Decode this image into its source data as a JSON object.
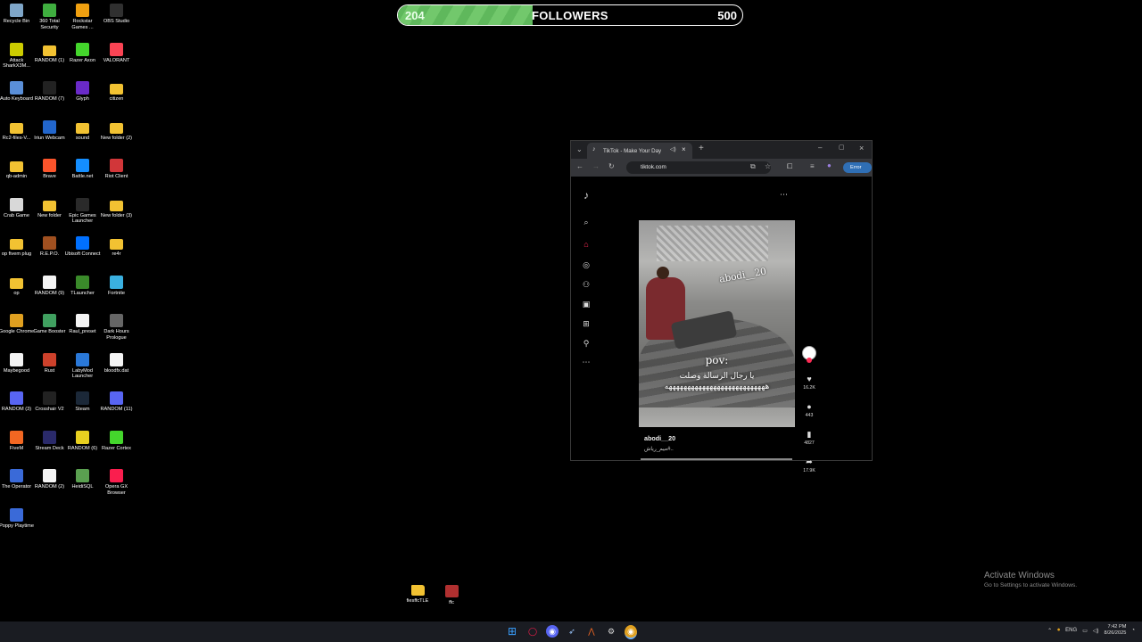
{
  "follower_bar": {
    "current": "204",
    "label": "FOLLOWERS",
    "goal": "500",
    "progress_fraction": 0.39
  },
  "desktop_icons": [
    {
      "label": "Recycle Bin",
      "icon": "recycle-bin-icon",
      "color": "#7fa6c8"
    },
    {
      "label": "360 Total Security",
      "icon": "shield-icon",
      "color": "#3fae3f"
    },
    {
      "label": "Rockstar Games ...",
      "icon": "rockstar-icon",
      "color": "#f0a010"
    },
    {
      "label": "OBS Studio",
      "icon": "obs-icon",
      "color": "#303030"
    },
    {
      "label": "Attack SharkX3M...",
      "icon": "mouse-icon",
      "color": "#cccc00"
    },
    {
      "label": "RANDOM (1)",
      "icon": "folder-icon",
      "color": "#f2c232"
    },
    {
      "label": "Razer Axon",
      "icon": "razer-icon",
      "color": "#44d62c"
    },
    {
      "label": "VALORANT",
      "icon": "valorant-icon",
      "color": "#fa4454"
    },
    {
      "label": "Auto Keyboard",
      "icon": "keyboard-icon",
      "color": "#5a8fd8"
    },
    {
      "label": "RANDOM (7)",
      "icon": "capcut-icon",
      "color": "#222222"
    },
    {
      "label": "Glyph",
      "icon": "glyph-icon",
      "color": "#6a2ac8"
    },
    {
      "label": "citizen",
      "icon": "folder-icon",
      "color": "#f2c232"
    },
    {
      "label": "Rc2-files-V...",
      "icon": "folder-icon",
      "color": "#f2c232"
    },
    {
      "label": "Iriun Webcam",
      "icon": "webcam-icon",
      "color": "#2266cc"
    },
    {
      "label": "sound",
      "icon": "folder-icon",
      "color": "#f2c232"
    },
    {
      "label": "New folder (2)",
      "icon": "folder-icon",
      "color": "#f2c232"
    },
    {
      "label": "qb-admin",
      "icon": "folder-icon",
      "color": "#f2c232"
    },
    {
      "label": "Brave",
      "icon": "brave-icon",
      "color": "#fb542b"
    },
    {
      "label": "Battle.net",
      "icon": "battlenet-icon",
      "color": "#148eff"
    },
    {
      "label": "Riot Client",
      "icon": "riot-icon",
      "color": "#d13639"
    },
    {
      "label": "Crab Game",
      "icon": "crab-icon",
      "color": "#d8d8d8"
    },
    {
      "label": "New folder",
      "icon": "folder-icon",
      "color": "#f2c232"
    },
    {
      "label": "Epic Games Launcher",
      "icon": "epic-icon",
      "color": "#2a2a2a"
    },
    {
      "label": "New folder (3)",
      "icon": "folder-icon",
      "color": "#f2c232"
    },
    {
      "label": "op fivem plug",
      "icon": "folder-icon",
      "color": "#f2c232"
    },
    {
      "label": "R.E.P.O.",
      "icon": "repo-icon",
      "color": "#a05020"
    },
    {
      "label": "Ubisoft Connect",
      "icon": "ubisoft-icon",
      "color": "#0070ff"
    },
    {
      "label": "re4r",
      "icon": "folder-icon",
      "color": "#f2c232"
    },
    {
      "label": "op",
      "icon": "folder-icon",
      "color": "#f2c232"
    },
    {
      "label": "RANDOM (9)",
      "icon": "file-icon",
      "color": "#f4f4f4"
    },
    {
      "label": "TLauncher",
      "icon": "tlauncher-icon",
      "color": "#3a8a2a"
    },
    {
      "label": "Fortnite",
      "icon": "fortnite-icon",
      "color": "#3ab0e0"
    },
    {
      "label": "Google Chrome",
      "icon": "chrome-icon",
      "color": "#e0a020"
    },
    {
      "label": "Game Booster",
      "icon": "game-booster-icon",
      "color": "#40a060"
    },
    {
      "label": "Raul_preset",
      "icon": "file-icon",
      "color": "#f4f4f4"
    },
    {
      "label": "Dark Hours Prologue",
      "icon": "dark-hours-icon",
      "color": "#666666"
    },
    {
      "label": "Maybegood",
      "icon": "file-icon",
      "color": "#f4f4f4"
    },
    {
      "label": "Rust",
      "icon": "rust-icon",
      "color": "#cd412b"
    },
    {
      "label": "LabyMod Launcher",
      "icon": "labymod-icon",
      "color": "#2a78d8"
    },
    {
      "label": "bloodfx.dat",
      "icon": "file-icon",
      "color": "#f4f4f4"
    },
    {
      "label": "RANDOM (3)",
      "icon": "discord-icon",
      "color": "#5865f2"
    },
    {
      "label": "Crosshair V2",
      "icon": "crosshair-icon",
      "color": "#222222"
    },
    {
      "label": "Steam",
      "icon": "steam-icon",
      "color": "#1b2838"
    },
    {
      "label": "RANDOM (11)",
      "icon": "discord-icon",
      "color": "#5865f2"
    },
    {
      "label": "FiveM",
      "icon": "fivem-icon",
      "color": "#f26722"
    },
    {
      "label": "Stream Deck",
      "icon": "stream-deck-icon",
      "color": "#2a2a6a"
    },
    {
      "label": "RANDOM (6)",
      "icon": "random-icon",
      "color": "#e8d020"
    },
    {
      "label": "Razer Cortex",
      "icon": "razer-cortex-icon",
      "color": "#44d62c"
    },
    {
      "label": "The Operator",
      "icon": "operator-icon",
      "color": "#3a6ad8"
    },
    {
      "label": "RANDOM (2)",
      "icon": "file-icon",
      "color": "#f4f4f4"
    },
    {
      "label": "HeidiSQL",
      "icon": "heidisql-icon",
      "color": "#5aa050"
    },
    {
      "label": "Opera GX Browser",
      "icon": "opera-gx-icon",
      "color": "#fa1e4e"
    },
    {
      "label": "Poppy Playtime",
      "icon": "poppy-icon",
      "color": "#3a6ad8"
    }
  ],
  "bottom_icons": [
    {
      "label": "fiesffcTLE",
      "icon": "folder-icon",
      "color": "#f2c232"
    },
    {
      "label": "ffc",
      "icon": "archive-icon",
      "color": "#b03030"
    }
  ],
  "browser": {
    "tab_title": "TikTok - Make Your Day",
    "url": "tiktok.com",
    "error_label": "Error",
    "more_menu": "⋯"
  },
  "tiktok": {
    "watermark": "abodi__20",
    "caption_line1": "pov:",
    "caption_line2": "يا رجال الرسالة وصلت",
    "caption_line3": "هههههههههههههههههههههههههههه",
    "author": "abodi__20",
    "description": "ميم_رياش#..",
    "likes": "16.2K",
    "comments": "443",
    "saves": "4827",
    "shares": "17.9K"
  },
  "activate_windows": {
    "title": "Activate Windows",
    "subtitle": "Go to Settings to activate Windows."
  },
  "taskbar": {
    "language": "ENG",
    "time": "7:42 PM",
    "date": "8/26/2025"
  }
}
